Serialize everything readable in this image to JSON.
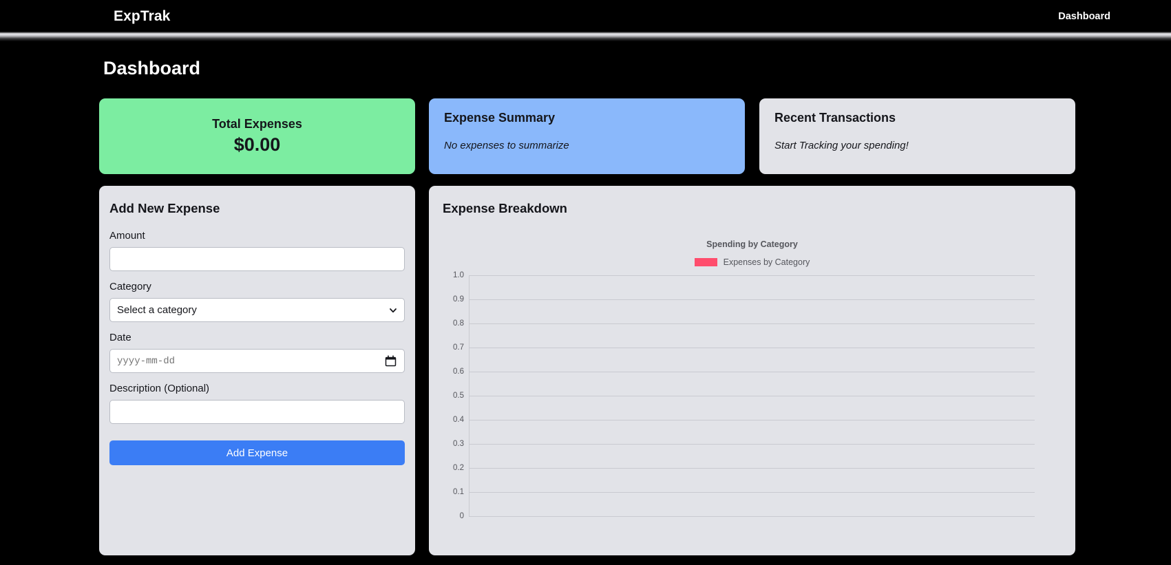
{
  "navbar": {
    "brand": "ExpTrak",
    "links": [
      {
        "label": "Dashboard",
        "name": "nav-link-dashboard"
      }
    ]
  },
  "page": {
    "title": "Dashboard"
  },
  "cards": {
    "total_expenses": {
      "title": "Total Expenses",
      "amount": "$0.00",
      "color": "#7ceda1"
    },
    "expense_summary": {
      "title": "Expense Summary",
      "note": "No expenses to summarize",
      "color": "#8ab8fb"
    },
    "recent_transactions": {
      "title": "Recent Transactions",
      "note": "Start Tracking your spending!",
      "color": "#e2e3e8"
    }
  },
  "form": {
    "heading": "Add New Expense",
    "amount": {
      "label": "Amount",
      "value": "",
      "placeholder": ""
    },
    "category": {
      "label": "Category",
      "selected": "Select a category",
      "options": [
        "Select a category"
      ]
    },
    "date": {
      "label": "Date",
      "value": "",
      "placeholder": "yyyy-mm-dd"
    },
    "description": {
      "label": "Description (Optional)",
      "value": "",
      "placeholder": ""
    },
    "submit_label": "Add Expense",
    "submit_color": "#3b7df5"
  },
  "chart_panel": {
    "heading": "Expense Breakdown"
  },
  "chart_data": {
    "type": "bar",
    "title": "Spending by Category",
    "xlabel": "",
    "ylabel": "",
    "categories": [],
    "values": [],
    "series": [
      {
        "name": "Expenses by Category",
        "color": "#ff4d6d",
        "values": []
      }
    ],
    "legend": [
      "Expenses by Category"
    ],
    "legend_position": "top",
    "grid": true,
    "ylim": [
      0,
      1
    ],
    "yticks": [
      "0",
      "0.1",
      "0.2",
      "0.3",
      "0.4",
      "0.5",
      "0.6",
      "0.7",
      "0.8",
      "0.9",
      "1.0"
    ]
  }
}
